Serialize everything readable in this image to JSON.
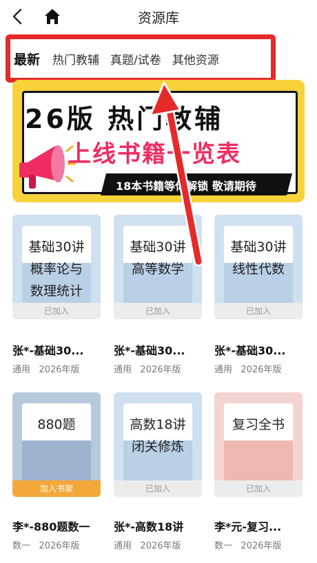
{
  "header": {
    "title": "资源库"
  },
  "tabs": [
    {
      "label": "最新",
      "active": true
    },
    {
      "label": "热门教辅",
      "active": false
    },
    {
      "label": "真题/试卷",
      "active": false
    },
    {
      "label": "其他资源",
      "active": false
    }
  ],
  "banner": {
    "line1": "26版 热门教辅",
    "line2": "上线书籍一览表",
    "line3": "18本书籍等你解锁 敬请期待"
  },
  "books": [
    {
      "cover_line1": "基础30讲",
      "cover_line2": "概率论与",
      "cover_line3": "数理统计",
      "tag": "已加入",
      "title": "张*-基础30...",
      "subject": "通用",
      "edition": "2026年版",
      "cover_color": "#cfe0f0",
      "cover_accent": "#b9d0e6"
    },
    {
      "cover_line1": "基础30讲",
      "cover_line2": "高等数学",
      "cover_line3": "",
      "tag": "已加入",
      "title": "张*-基础30...",
      "subject": "通用",
      "edition": "2026年版",
      "cover_color": "#cfe0f0",
      "cover_accent": "#b9d0e6"
    },
    {
      "cover_line1": "基础30讲",
      "cover_line2": "线性代数",
      "cover_line3": "",
      "tag": "已加入",
      "title": "张*-基础30...",
      "subject": "通用",
      "edition": "2026年版",
      "cover_color": "#cfe0f0",
      "cover_accent": "#b9d0e6"
    },
    {
      "cover_line1": "880题",
      "cover_line2": "",
      "cover_line3": "",
      "tag": "加入书架",
      "title": "李*-880题数一",
      "subject": "数一",
      "edition": "2026年版",
      "cover_color": "#b7c9dd",
      "cover_accent": "#9db3cf"
    },
    {
      "cover_line1": "高数18讲",
      "cover_line2": "闭关修炼",
      "cover_line3": "",
      "tag": "已加入",
      "title": "张*-高数18讲",
      "subject": "通用",
      "edition": "2026年版",
      "cover_color": "#cfe0f0",
      "cover_accent": "#b9d0e6"
    },
    {
      "cover_line1": "复习全书",
      "cover_line2": "",
      "cover_line3": "",
      "tag": "已加入",
      "title": "李*元-复习...",
      "subject": "数一",
      "edition": "2026年版",
      "cover_color": "#f4d4d0",
      "cover_accent": "#eeb7b0"
    }
  ],
  "colors": {
    "highlight": "#e62a2a",
    "banner_yellow": "#f7d23a",
    "banner_pink": "#ef2d62",
    "tag_orange": "#f5a83a"
  }
}
